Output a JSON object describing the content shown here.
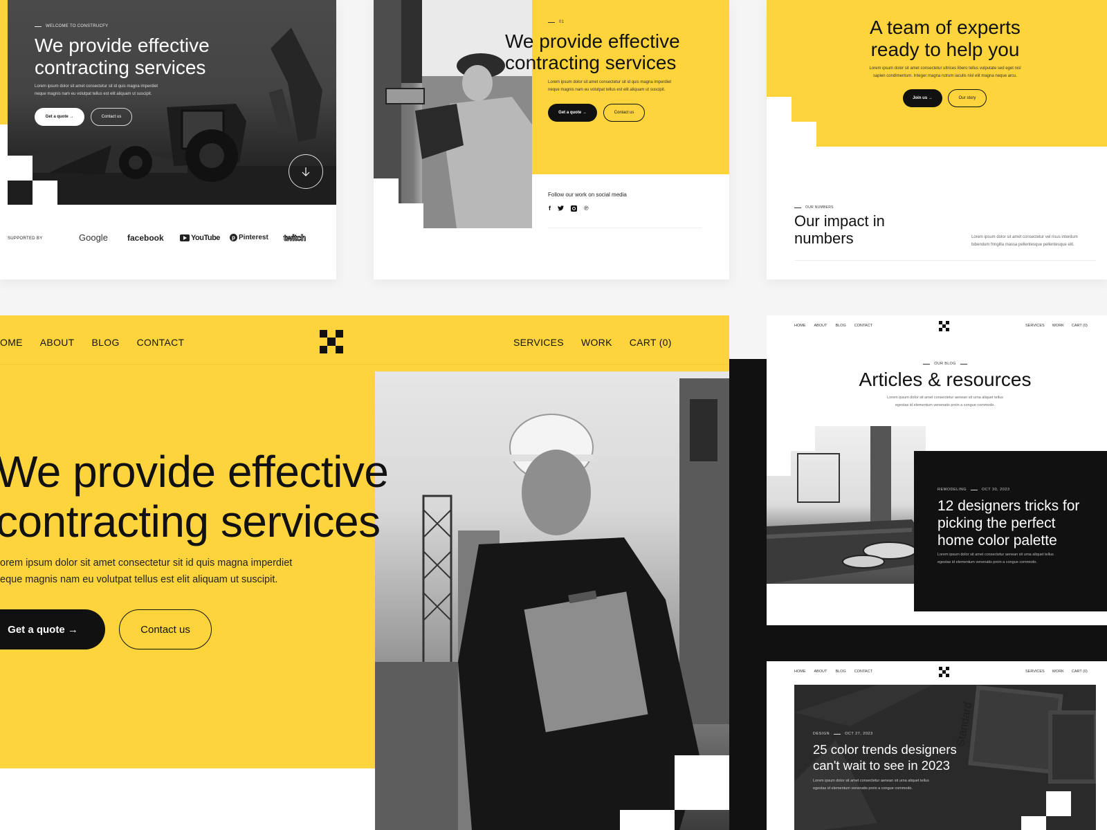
{
  "brand": {
    "name": "Construcfy",
    "colors": {
      "accent": "#fed43c",
      "dark": "#111111",
      "light": "#ffffff"
    }
  },
  "card1": {
    "eyebrow": "WELCOME TO CONSTRUCFY",
    "title_line1": "We provide effective",
    "title_line2": "contracting services",
    "body_line1": "Lorem ipsum dolor sit amet consectetur sit id quis magna imperdiet",
    "body_line2": "neque magnis nam eu volutpat tellus est elit aliquam ut suscipit.",
    "primary_button": "Get a quote →",
    "secondary_button": "Contact us",
    "scroll_icon": "arrow-down-icon",
    "supported_label": "SUPPORTED BY",
    "partners": [
      "Google",
      "facebook",
      "YouTube",
      "Pinterest",
      "twitch"
    ]
  },
  "card2": {
    "eyebrow": "01",
    "title_line1": "We provide effective",
    "title_line2": "contracting services",
    "body_line1": "Lorem ipsum dolor sit amet consectetur sit id quis magna imperdiet",
    "body_line2": "neque magnis nam eu volutpat tellus est elit aliquam ut suscipit.",
    "primary_button": "Get a quote →",
    "secondary_button": "Contact us",
    "social_label": "Follow our work on social media",
    "social_icons": [
      "facebook-icon",
      "twitter-icon",
      "instagram-icon",
      "pinterest-icon"
    ]
  },
  "card3": {
    "title_line1": "A team of experts",
    "title_line2": "ready to help you",
    "body_line1": "Lorem ipsum dolor sit amet consectetur ultrices libero tellus vulputate sed eget nisl",
    "body_line2": "sapien condimentum. Integer magna rutrum iaculis nisl elit magna neque arcu.",
    "primary_button": "Join us →",
    "secondary_button": "Our story",
    "numbers_eyebrow": "OUR NUMBERS",
    "numbers_title_line1": "Our impact in",
    "numbers_title_line2": "numbers",
    "numbers_body_line1": "Lorem ipsum dolor sit amet consectetur vel risus interdum",
    "numbers_body_line2": "bibendum fringilla massa pellentesque pellentesque elit."
  },
  "nav": {
    "left": [
      "HOME",
      "ABOUT",
      "BLOG",
      "CONTACT"
    ],
    "right": [
      "SERVICES",
      "WORK",
      "CART (0)"
    ]
  },
  "card4": {
    "nav_left_first": "OME",
    "title_line1": "We provide effective",
    "title_line2": "contracting services",
    "body_line1": "orem ipsum dolor sit amet consectetur sit id quis magna imperdiet",
    "body_line2": "eque magnis nam eu volutpat tellus est elit aliquam ut suscipit.",
    "primary_button": "Get a quote →",
    "secondary_button": "Contact us"
  },
  "card5": {
    "eyebrow": "OUR BLOG",
    "title": "Articles & resources",
    "body_line1": "Lorem ipsum dolor sit amet consectetur aenean sit urna aliquet tellus",
    "body_line2": "egestas id elementum venenatis proin a congue commodo.",
    "post": {
      "category": "REMODELING",
      "date": "OCT 30, 2023",
      "title_line1": "12 designers tricks for",
      "title_line2": "picking the perfect",
      "title_line3": "home color palette",
      "body_line1": "Lorem ipsum dolor sit amet consectetur aenean sit urna aliquet tellus",
      "body_line2": "egestas id elementum venenatis proin a congue commodo."
    }
  },
  "card6": {
    "post": {
      "category": "DESIGN",
      "date": "OCT 27, 2023",
      "title_line1": "25 color trends designers",
      "title_line2": "can't wait to see in 2023",
      "body_line1": "Lorem ipsum dolor sit amet consectetur aenean sit urna aliquet tellus",
      "body_line2": "egestas id elementum venenatis proin a congue commodo."
    }
  }
}
